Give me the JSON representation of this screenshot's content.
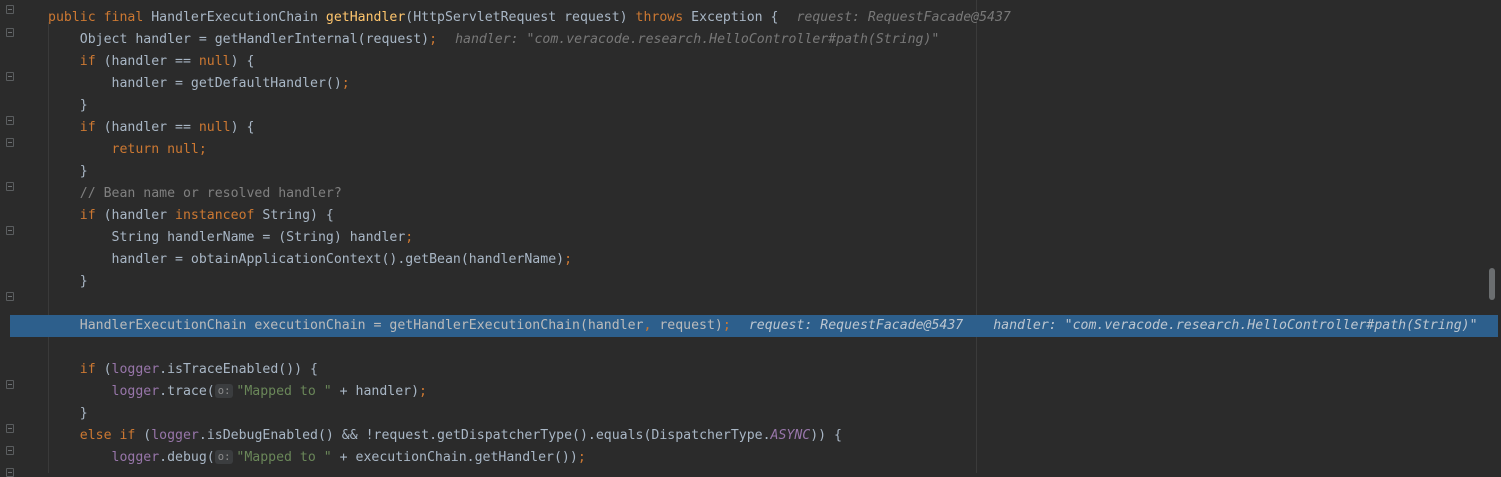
{
  "lines": [
    {
      "segments": [
        {
          "cls": "kw",
          "text": "public final "
        },
        {
          "cls": "",
          "text": "HandlerExecutionChain "
        },
        {
          "cls": "fn",
          "text": "getHandler"
        },
        {
          "cls": "",
          "text": "(HttpServletRequest request) "
        },
        {
          "cls": "kw",
          "text": "throws "
        },
        {
          "cls": "",
          "text": "Exception {"
        },
        {
          "cls": "hint",
          "text": "request: RequestFacade@5437"
        }
      ]
    },
    {
      "segments": [
        {
          "cls": "",
          "text": "    Object handler = getHandlerInternal(request)"
        },
        {
          "cls": "kw",
          "text": ";"
        },
        {
          "cls": "hint",
          "text": "handler: \"com.veracode.research.HelloController#path(String)\""
        }
      ]
    },
    {
      "segments": [
        {
          "cls": "kw",
          "text": "    if "
        },
        {
          "cls": "",
          "text": "(handler == "
        },
        {
          "cls": "kw",
          "text": "null"
        },
        {
          "cls": "",
          "text": ") {"
        }
      ]
    },
    {
      "segments": [
        {
          "cls": "",
          "text": "        handler = getDefaultHandler()"
        },
        {
          "cls": "kw",
          "text": ";"
        }
      ]
    },
    {
      "segments": [
        {
          "cls": "",
          "text": "    }"
        }
      ]
    },
    {
      "segments": [
        {
          "cls": "kw",
          "text": "    if "
        },
        {
          "cls": "",
          "text": "(handler == "
        },
        {
          "cls": "kw",
          "text": "null"
        },
        {
          "cls": "",
          "text": ") {"
        }
      ]
    },
    {
      "segments": [
        {
          "cls": "kw",
          "text": "        return null;"
        }
      ]
    },
    {
      "segments": [
        {
          "cls": "",
          "text": "    }"
        }
      ]
    },
    {
      "segments": [
        {
          "cls": "cm",
          "text": "    // Bean name or resolved handler?"
        }
      ]
    },
    {
      "segments": [
        {
          "cls": "kw",
          "text": "    if "
        },
        {
          "cls": "",
          "text": "(handler "
        },
        {
          "cls": "kw",
          "text": "instanceof "
        },
        {
          "cls": "",
          "text": "String) {"
        }
      ]
    },
    {
      "segments": [
        {
          "cls": "",
          "text": "        String handlerName = (String) handler"
        },
        {
          "cls": "kw",
          "text": ";"
        }
      ]
    },
    {
      "segments": [
        {
          "cls": "",
          "text": "        handler = obtainApplicationContext().getBean(handlerName)"
        },
        {
          "cls": "kw",
          "text": ";"
        }
      ]
    },
    {
      "segments": [
        {
          "cls": "",
          "text": "    }"
        }
      ]
    },
    {
      "segments": []
    },
    {
      "exec": true,
      "segments": [
        {
          "cls": "",
          "text": "    HandlerExecutionChain executionChain = getHandlerExecutionChain(handler"
        },
        {
          "cls": "kw",
          "text": ", "
        },
        {
          "cls": "",
          "text": "request)"
        },
        {
          "cls": "kw",
          "text": ";"
        },
        {
          "cls": "hint",
          "text": "request: RequestFacade@5437"
        },
        {
          "cls": "hint hint2",
          "text": "handler: \"com.veracode.research.HelloController#path(String)\""
        }
      ]
    },
    {
      "segments": []
    },
    {
      "segments": [
        {
          "cls": "kw",
          "text": "    if "
        },
        {
          "cls": "",
          "text": "("
        },
        {
          "cls": "fld",
          "text": "logger"
        },
        {
          "cls": "",
          "text": ".isTraceEnabled()) {"
        }
      ]
    },
    {
      "segments": [
        {
          "cls": "",
          "text": "        "
        },
        {
          "cls": "fld",
          "text": "logger"
        },
        {
          "cls": "",
          "text": ".trace("
        },
        {
          "cls": "pm",
          "text": "o:"
        },
        {
          "cls": "str",
          "text": "\"Mapped to \" "
        },
        {
          "cls": "",
          "text": "+ handler)"
        },
        {
          "cls": "kw",
          "text": ";"
        }
      ]
    },
    {
      "segments": [
        {
          "cls": "",
          "text": "    }"
        }
      ]
    },
    {
      "segments": [
        {
          "cls": "kw",
          "text": "    else if "
        },
        {
          "cls": "",
          "text": "("
        },
        {
          "cls": "fld",
          "text": "logger"
        },
        {
          "cls": "",
          "text": ".isDebugEnabled() && !request.getDispatcherType().equals(DispatcherType."
        },
        {
          "cls": "cst",
          "text": "ASYNC"
        },
        {
          "cls": "",
          "text": ")) {"
        }
      ]
    },
    {
      "segments": [
        {
          "cls": "",
          "text": "        "
        },
        {
          "cls": "fld",
          "text": "logger"
        },
        {
          "cls": "",
          "text": ".debug("
        },
        {
          "cls": "pm",
          "text": "o:"
        },
        {
          "cls": "str",
          "text": "\"Mapped to \" "
        },
        {
          "cls": "",
          "text": "+ executionChain.getHandler())"
        },
        {
          "cls": "kw",
          "text": ";"
        }
      ]
    }
  ]
}
